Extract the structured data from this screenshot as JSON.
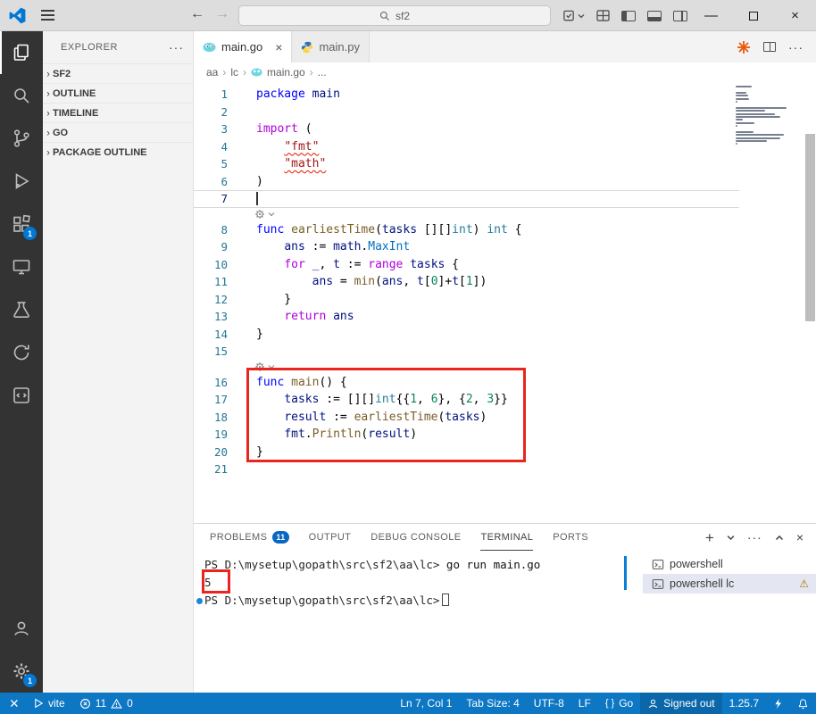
{
  "colors": {
    "accent": "#0d77c4",
    "badge": "#0078d4",
    "annotation": "#e8261f",
    "error_squiggle": "#e51400"
  },
  "titlebar": {
    "search_value": "sf2"
  },
  "activity_bar": {
    "extensions_badge": "1",
    "settings_badge": "1"
  },
  "sidebar": {
    "title": "EXPLORER",
    "sections": [
      {
        "label": "SF2"
      },
      {
        "label": "OUTLINE"
      },
      {
        "label": "TIMELINE"
      },
      {
        "label": "GO"
      },
      {
        "label": "PACKAGE OUTLINE"
      }
    ]
  },
  "tabs": [
    {
      "label": "main.go",
      "icon": "go",
      "active": true
    },
    {
      "label": "main.py",
      "icon": "python",
      "active": false
    }
  ],
  "breadcrumb": [
    "aa",
    "lc",
    "main.go",
    "..."
  ],
  "editor": {
    "lines": [
      {
        "n": "1",
        "tokens": [
          [
            "kw",
            "package"
          ],
          [
            "pl",
            " "
          ],
          [
            "ns",
            "main"
          ]
        ]
      },
      {
        "n": "2",
        "tokens": []
      },
      {
        "n": "3",
        "tokens": [
          [
            "ctrl",
            "import"
          ],
          [
            "pl",
            " ("
          ]
        ]
      },
      {
        "n": "4",
        "tokens": [
          [
            "pl",
            "    "
          ],
          [
            "strr",
            "\"fmt\""
          ]
        ]
      },
      {
        "n": "5",
        "tokens": [
          [
            "pl",
            "    "
          ],
          [
            "strr",
            "\"math\""
          ]
        ]
      },
      {
        "n": "6",
        "tokens": [
          [
            "pl",
            ")"
          ]
        ]
      },
      {
        "n": "7",
        "tokens": [],
        "current": true
      },
      {
        "lens": true
      },
      {
        "n": "8",
        "tokens": [
          [
            "kw",
            "func"
          ],
          [
            "pl",
            " "
          ],
          [
            "fn",
            "earliestTime"
          ],
          [
            "pl",
            "("
          ],
          [
            "vr",
            "tasks"
          ],
          [
            "pl",
            " [][]"
          ],
          [
            "ty",
            "int"
          ],
          [
            "pl",
            ") "
          ],
          [
            "ty",
            "int"
          ],
          [
            "pl",
            " {"
          ]
        ]
      },
      {
        "n": "9",
        "tokens": [
          [
            "pl",
            "    "
          ],
          [
            "vr",
            "ans"
          ],
          [
            "pl",
            " := "
          ],
          [
            "ns",
            "math"
          ],
          [
            "pl",
            "."
          ],
          [
            "cst",
            "MaxInt"
          ]
        ]
      },
      {
        "n": "10",
        "tokens": [
          [
            "pl",
            "    "
          ],
          [
            "ctrl",
            "for"
          ],
          [
            "pl",
            " "
          ],
          [
            "vr",
            "_"
          ],
          [
            "pl",
            ", "
          ],
          [
            "vr",
            "t"
          ],
          [
            "pl",
            " := "
          ],
          [
            "ctrl",
            "range"
          ],
          [
            "pl",
            " "
          ],
          [
            "vr",
            "tasks"
          ],
          [
            "pl",
            " {"
          ]
        ]
      },
      {
        "n": "11",
        "tokens": [
          [
            "pl",
            "        "
          ],
          [
            "vr",
            "ans"
          ],
          [
            "pl",
            " = "
          ],
          [
            "fn",
            "min"
          ],
          [
            "pl",
            "("
          ],
          [
            "vr",
            "ans"
          ],
          [
            "pl",
            ", "
          ],
          [
            "vr",
            "t"
          ],
          [
            "pl",
            "["
          ],
          [
            "num",
            "0"
          ],
          [
            "pl",
            "]+"
          ],
          [
            "vr",
            "t"
          ],
          [
            "pl",
            "["
          ],
          [
            "num",
            "1"
          ],
          [
            "pl",
            "])"
          ]
        ]
      },
      {
        "n": "12",
        "tokens": [
          [
            "pl",
            "    }"
          ]
        ]
      },
      {
        "n": "13",
        "tokens": [
          [
            "pl",
            "    "
          ],
          [
            "ctrl",
            "return"
          ],
          [
            "pl",
            " "
          ],
          [
            "vr",
            "ans"
          ]
        ]
      },
      {
        "n": "14",
        "tokens": [
          [
            "pl",
            "}"
          ]
        ]
      },
      {
        "n": "15",
        "tokens": []
      },
      {
        "lens": true
      },
      {
        "n": "16",
        "tokens": [
          [
            "kw",
            "func"
          ],
          [
            "pl",
            " "
          ],
          [
            "fn",
            "main"
          ],
          [
            "pl",
            "() {"
          ]
        ]
      },
      {
        "n": "17",
        "tokens": [
          [
            "pl",
            "    "
          ],
          [
            "vr",
            "tasks"
          ],
          [
            "pl",
            " := [][]"
          ],
          [
            "ty",
            "int"
          ],
          [
            "pl",
            "{{"
          ],
          [
            "num",
            "1"
          ],
          [
            "pl",
            ", "
          ],
          [
            "num",
            "6"
          ],
          [
            "pl",
            "}, {"
          ],
          [
            "num",
            "2"
          ],
          [
            "pl",
            ", "
          ],
          [
            "num",
            "3"
          ],
          [
            "pl",
            "}}"
          ]
        ]
      },
      {
        "n": "18",
        "tokens": [
          [
            "pl",
            "    "
          ],
          [
            "vr",
            "result"
          ],
          [
            "pl",
            " := "
          ],
          [
            "fn",
            "earliestTime"
          ],
          [
            "pl",
            "("
          ],
          [
            "vr",
            "tasks"
          ],
          [
            "pl",
            ")"
          ]
        ]
      },
      {
        "n": "19",
        "tokens": [
          [
            "pl",
            "    "
          ],
          [
            "ns",
            "fmt"
          ],
          [
            "pl",
            "."
          ],
          [
            "fn",
            "Println"
          ],
          [
            "pl",
            "("
          ],
          [
            "vr",
            "result"
          ],
          [
            "pl",
            ")"
          ]
        ]
      },
      {
        "n": "20",
        "tokens": [
          [
            "pl",
            "}"
          ]
        ]
      },
      {
        "n": "21",
        "tokens": []
      }
    ]
  },
  "panel": {
    "tabs": [
      {
        "label": "PROBLEMS",
        "badge": "11"
      },
      {
        "label": "OUTPUT"
      },
      {
        "label": "DEBUG CONSOLE"
      },
      {
        "label": "TERMINAL",
        "active": true
      },
      {
        "label": "PORTS"
      }
    ],
    "terminal": {
      "lines": [
        {
          "prompt": "PS D:\\mysetup\\gopath\\src\\sf2\\aa\\lc>",
          "command": " go run main.go"
        },
        {
          "output": "5"
        },
        {
          "prompt": "PS D:\\mysetup\\gopath\\src\\sf2\\aa\\lc>",
          "cursor": true,
          "dot": true
        }
      ]
    },
    "terminal_list": [
      {
        "label": "powershell",
        "selected": false,
        "warning": false
      },
      {
        "label": "powershell lc",
        "selected": true,
        "warning": true
      }
    ]
  },
  "statusbar": {
    "vite": "vite",
    "errors": "11",
    "warnings": "0",
    "ln_col": "Ln 7, Col 1",
    "tab_size": "Tab Size: 4",
    "encoding": "UTF-8",
    "eol": "LF",
    "lang_braces": "{ }",
    "lang": "Go",
    "account": "Signed out",
    "version": "1.25.7"
  }
}
